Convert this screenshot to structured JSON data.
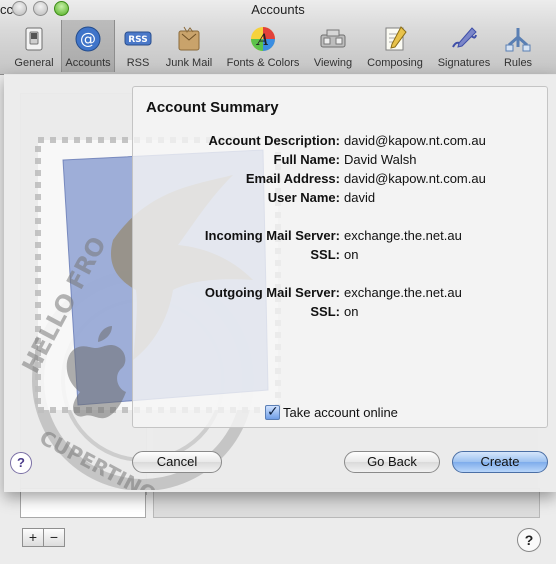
{
  "window": {
    "title": "Accounts",
    "left_title_fragment": "ccs"
  },
  "toolbar": {
    "items": [
      {
        "label": "General",
        "icon": "general-switch-icon"
      },
      {
        "label": "Accounts",
        "icon": "at-sign-icon",
        "selected": true
      },
      {
        "label": "RSS",
        "icon": "rss-icon"
      },
      {
        "label": "Junk Mail",
        "icon": "junk-mail-icon"
      },
      {
        "label": "Fonts & Colors",
        "icon": "fonts-colors-icon"
      },
      {
        "label": "Viewing",
        "icon": "viewing-icon"
      },
      {
        "label": "Composing",
        "icon": "composing-icon"
      },
      {
        "label": "Signatures",
        "icon": "signatures-icon"
      },
      {
        "label": "Rules",
        "icon": "rules-icon"
      }
    ]
  },
  "sheet": {
    "heading": "Account Summary",
    "rows": [
      {
        "key": "Account Description:",
        "value": "david@kapow.nt.com.au"
      },
      {
        "key": "Full Name:",
        "value": "David Walsh"
      },
      {
        "key": "Email Address:",
        "value": "david@kapow.nt.com.au"
      },
      {
        "key": "User Name:",
        "value": "david"
      },
      {
        "key": "Incoming Mail Server:",
        "value": "exchange.the.net.au"
      },
      {
        "key": "SSL:",
        "value": "on"
      },
      {
        "key": "Outgoing Mail Server:",
        "value": "exchange.the.net.au"
      },
      {
        "key": "SSL:",
        "value": "on"
      }
    ],
    "checkbox_label": "Take account online",
    "checkbox_checked": true,
    "buttons": {
      "help": "?",
      "cancel": "Cancel",
      "go_back": "Go Back",
      "create": "Create"
    },
    "stamp_text": {
      "line1": "HELLO FRO",
      "line2": "CUPERTINO CA"
    }
  },
  "background_pane": {
    "plus": "+",
    "minus": "−",
    "help": "?"
  },
  "colors": {
    "primary_button": "#7eaceb",
    "selected_tool": "#a9a9a9"
  }
}
